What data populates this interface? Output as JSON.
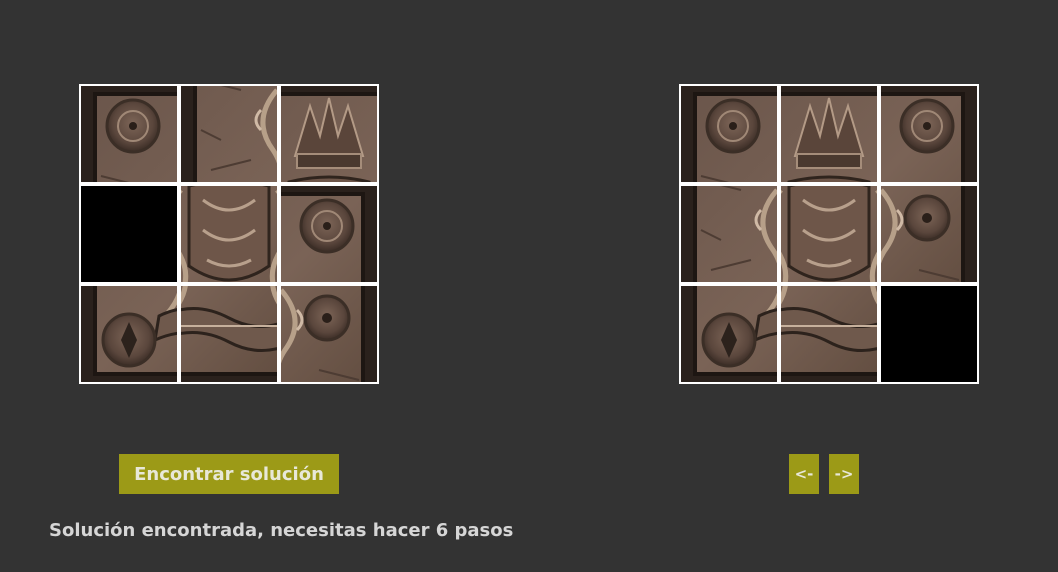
{
  "colors": {
    "background": "#333333",
    "button": "#9c9a17",
    "button_text": "#e8e8d8",
    "status_text": "#d6d6d6",
    "grid_lines": "#ffffff",
    "empty_tile": "#000000"
  },
  "puzzle_current": {
    "tiles": [
      "1",
      "4",
      "2",
      "empty",
      "5",
      "3",
      "7",
      "8",
      "6"
    ]
  },
  "puzzle_goal": {
    "tiles": [
      "1",
      "2",
      "3",
      "4",
      "5",
      "6",
      "7",
      "8",
      "empty"
    ]
  },
  "buttons": {
    "solve_label": "Encontrar solución",
    "prev_label": "<-",
    "next_label": "->"
  },
  "status": {
    "message": "Solución encontrada, necesitas hacer 6 pasos"
  }
}
